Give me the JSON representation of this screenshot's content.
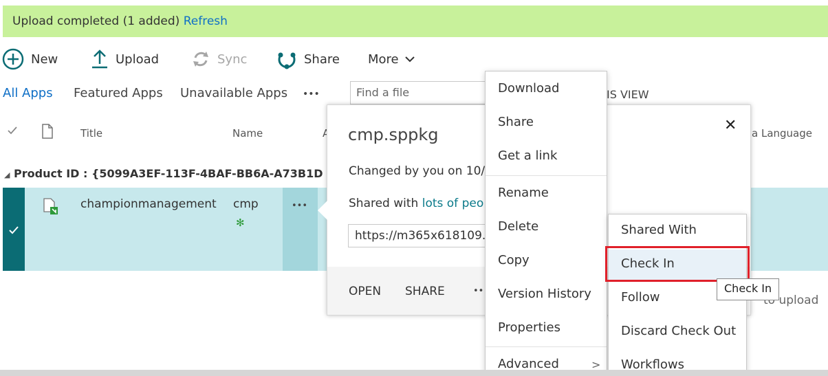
{
  "banner": {
    "message": "Upload completed (1 added)",
    "refresh_link": "Refresh"
  },
  "command_bar": {
    "new": "New",
    "upload": "Upload",
    "sync": "Sync",
    "share": "Share",
    "more": "More"
  },
  "view_tabs": {
    "all_apps": "All Apps",
    "featured_apps": "Featured Apps",
    "unavailable_apps": "Unavailable Apps",
    "more": "•••",
    "find_placeholder": "Find a file",
    "save_view_fragment": "IS VIEW"
  },
  "columns": {
    "title": "Title",
    "name": "Name",
    "name_next_fragment": "A",
    "language_fragment": "a Language"
  },
  "group": {
    "label": "Product ID : {5099A3EF-113F-4BAF-BB6A-A73B1D"
  },
  "row": {
    "title": "championmanagement",
    "name": "cmp",
    "new_badge": "✻",
    "ellipsis": "•••"
  },
  "callout": {
    "filename": "cmp.sppkg",
    "changed_by": "Changed by you on 10/",
    "shared_with_prefix": "Shared with",
    "shared_with_link": "lots of peo",
    "url_value": "https://m365x618109.",
    "open": "OPEN",
    "share": "SHARE",
    "more": "••",
    "close": "✕"
  },
  "context_menu": {
    "items": [
      "Download",
      "Share",
      "Get a link",
      "Rename",
      "Delete",
      "Copy",
      "Version History",
      "Properties",
      "Advanced"
    ],
    "advanced_arrow": ">"
  },
  "advanced_submenu": {
    "items": [
      "Shared With",
      "Check In",
      "Follow",
      "Discard Check Out",
      "Workflows"
    ]
  },
  "tooltip": {
    "text": "Check In"
  },
  "drop_hint_fragment": "to upload",
  "colors": {
    "banner_bg": "#c8f19b",
    "link": "#0f6fc6",
    "selected_row": "#c7e8ec",
    "row_check": "#0b6c74",
    "highlight_box": "#e0202a"
  }
}
